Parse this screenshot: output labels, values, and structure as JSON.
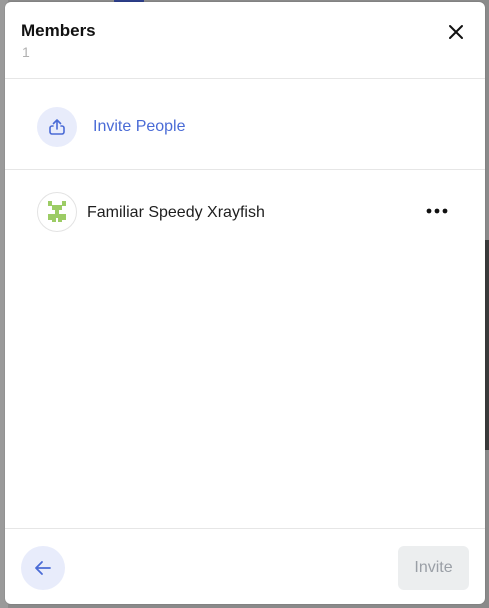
{
  "dialog": {
    "title": "Members",
    "member_count": "1",
    "close_icon": "close-icon"
  },
  "invite": {
    "icon": "share-upload-icon",
    "label": "Invite People"
  },
  "members": [
    {
      "name": "Familiar Speedy Xrayfish",
      "avatar_icon": "identicon-avatar",
      "menu_icon": "more-horizontal-icon"
    }
  ],
  "footer": {
    "back_icon": "arrow-left-icon",
    "invite_button_label": "Invite",
    "invite_button_disabled": true
  },
  "colors": {
    "accent": "#4a6bd6",
    "accent_bg": "#e8ecfb",
    "avatar_green": "#9ccc65",
    "disabled_bg": "#eceeef",
    "disabled_text": "#9a9fa6"
  }
}
